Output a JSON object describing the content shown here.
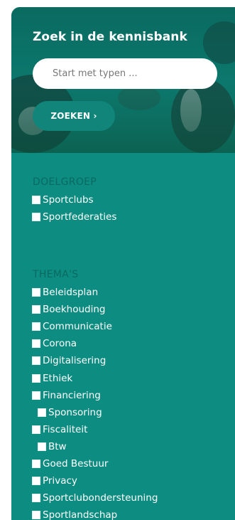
{
  "search": {
    "title": "Zoek in de kennisbank",
    "placeholder": "Start met typen ...",
    "button_label": "ZOEKEN ›"
  },
  "doelgroep": {
    "title": "DOELGROEP",
    "items": [
      {
        "label": "Sportclubs"
      },
      {
        "label": "Sportfederaties"
      }
    ]
  },
  "themas": {
    "title": "THEMA'S",
    "items": [
      {
        "label": "Beleidsplan"
      },
      {
        "label": "Boekhouding"
      },
      {
        "label": "Communicatie"
      },
      {
        "label": "Corona"
      },
      {
        "label": "Digitalisering"
      },
      {
        "label": "Ethiek"
      },
      {
        "label": "Financiering"
      },
      {
        "label": "Sponsoring",
        "indent": 1
      },
      {
        "label": "Fiscaliteit"
      },
      {
        "label": "Btw",
        "indent": 1
      },
      {
        "label": "Goed Bestuur"
      },
      {
        "label": "Privacy"
      },
      {
        "label": "Sportclubondersteuning"
      },
      {
        "label": "Sportlandschap"
      }
    ]
  },
  "colors": {
    "panel": "#0d8c81",
    "section_title": "#0a6a61",
    "button": "#11857a"
  }
}
